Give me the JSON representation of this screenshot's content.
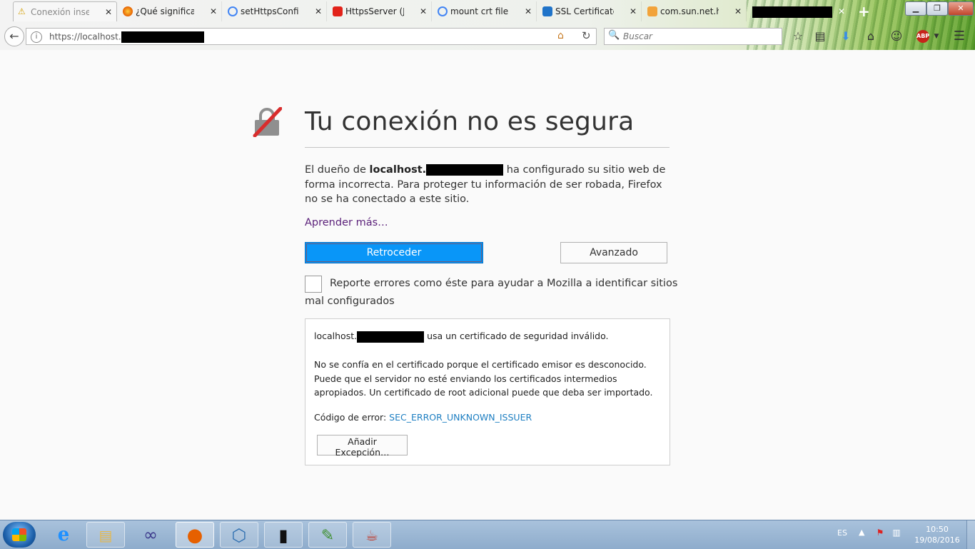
{
  "tabs": [
    {
      "label": "Conexión inse...",
      "icon": "warning-icon",
      "color": "#f1c40f",
      "active": true
    },
    {
      "label": "¿Qué significa '...",
      "icon": "firefox-icon",
      "color": "#e66000",
      "active": false
    },
    {
      "label": "setHttpsConfig...",
      "icon": "google-icon",
      "color": "#4285f4",
      "active": false
    },
    {
      "label": "HttpsServer (Ja...",
      "icon": "oracle-icon",
      "color": "#e2231a",
      "active": false
    },
    {
      "label": "mount crt file ...",
      "icon": "google-icon",
      "color": "#4285f4",
      "active": false
    },
    {
      "label": "SSL Certificate ...",
      "icon": "jira-icon",
      "color": "#2074c9",
      "active": false
    },
    {
      "label": "com.sun.net.htt...",
      "icon": "stackoverflow-icon",
      "color": "#f2a33a",
      "active": false
    }
  ],
  "new_tab_label": "+",
  "window_controls": {
    "minimize": "▁",
    "maximize": "❐",
    "close": "✕"
  },
  "navbar": {
    "back_glyph": "←",
    "url": "https://localhost.",
    "search_placeholder": "Buscar",
    "search_glyph": "🔍",
    "home_glyph": "⌂",
    "reload_glyph": "↻",
    "abp_label": "ABP"
  },
  "page": {
    "title": "Tu conexión no es segura",
    "desc_prefix": "El dueño de ",
    "desc_host": "localhost.",
    "desc_suffix": " ha configurado su sitio web de forma incorrecta. Para proteger tu información de ser robada, Firefox no se ha conectado a este sitio.",
    "learn_more": "Aprender más…",
    "back_button": "Retroceder",
    "advanced_button": "Avanzado",
    "report_label": "Reporte errores como éste para ayudar a Mozilla a identificar sitios mal configurados",
    "adv_host": "localhost.",
    "adv_suffix": " usa un certificado de seguridad inválido.",
    "adv_detail": "No se confía en el certificado porque el certificado emisor es desconocido. Puede que el servidor no esté enviando los certificados intermedios apropiados. Un certificado de root adicional puede que deba ser importado.",
    "error_label": "Código de error: ",
    "error_code": "SEC_ERROR_UNKNOWN_ISSUER",
    "add_exception_button": "Añadir Excepción…"
  },
  "taskbar": {
    "apps": [
      {
        "name": "ie",
        "icon": "internet-explorer-icon",
        "glyph": "e",
        "color": "#1e90ff"
      },
      {
        "name": "explorer",
        "icon": "folder-icon",
        "glyph": "▤",
        "color": "#e6b84a"
      },
      {
        "name": "eclipse",
        "icon": "eclipse-icon",
        "glyph": "∞",
        "color": "#3d3a8c"
      },
      {
        "name": "firefox",
        "icon": "firefox-icon",
        "glyph": "●",
        "color": "#e66000"
      },
      {
        "name": "virtualbox",
        "icon": "virtualbox-icon",
        "glyph": "⬡",
        "color": "#2f6fb0"
      },
      {
        "name": "cmd",
        "icon": "command-prompt-icon",
        "glyph": "▮",
        "color": "#111111"
      },
      {
        "name": "notepad",
        "icon": "notepad-icon",
        "glyph": "✎",
        "color": "#3e8f2f"
      },
      {
        "name": "java",
        "icon": "java-icon",
        "glyph": "☕",
        "color": "#c0392b"
      }
    ],
    "language": "ES",
    "tray_arrow": "▲",
    "time": "10:50",
    "date": "19/08/2016"
  }
}
